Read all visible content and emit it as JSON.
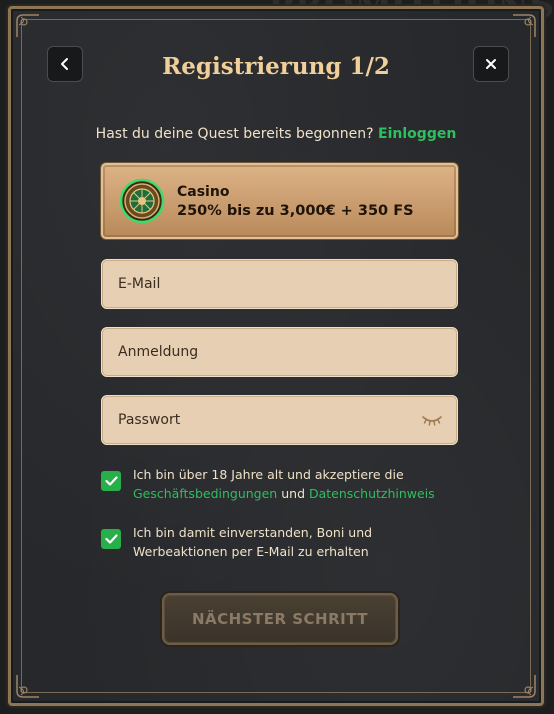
{
  "background": {
    "text": "PROMOTIONS"
  },
  "header": {
    "title": "Registrierung 1/2"
  },
  "login": {
    "question": "Hast du deine Quest bereits begonnen?",
    "link": "Einloggen"
  },
  "promo": {
    "title": "Casino",
    "offer": "250% bis zu 3,000€ + 350 FS",
    "icon": "roulette-wheel-icon"
  },
  "form": {
    "email_placeholder": "E-Mail",
    "username_placeholder": "Anmeldung",
    "password_placeholder": "Passwort"
  },
  "consents": {
    "age": {
      "checked": true,
      "text": "Ich bin über 18 Jahre alt und akzeptiere die",
      "terms_link": "Geschäftsbedingungen",
      "connector": "und",
      "privacy_link": "Datenschutzhinweis"
    },
    "marketing": {
      "checked": true,
      "text": "Ich bin damit einverstanden, Boni und Werbeaktionen per E-Mail zu erhalten"
    }
  },
  "actions": {
    "next": "NÄCHSTER SCHRITT"
  },
  "colors": {
    "accent_green": "#2ebf5e",
    "checkbox_green": "#27b049",
    "title_gold": "#f0cf9a",
    "field_bg": "#e6cfb2",
    "frame_bronze": "#8c7656"
  }
}
